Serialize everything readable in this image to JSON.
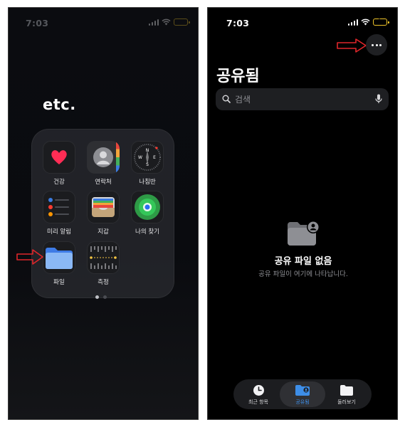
{
  "left": {
    "status": {
      "time": "7:03"
    },
    "folder_title": "etc.",
    "apps": [
      {
        "label": "건강",
        "icon": "health-heart-icon"
      },
      {
        "label": "연락처",
        "icon": "contacts-icon"
      },
      {
        "label": "나침반",
        "icon": "compass-icon"
      },
      {
        "label": "미리 알림",
        "icon": "reminders-icon"
      },
      {
        "label": "지갑",
        "icon": "wallet-icon"
      },
      {
        "label": "나의 찾기",
        "icon": "find-my-icon"
      },
      {
        "label": "파일",
        "icon": "files-folder-icon"
      },
      {
        "label": "측정",
        "icon": "measure-icon"
      }
    ],
    "compass_letters": {
      "n": "N",
      "e": "E",
      "s": "S",
      "w": "W"
    }
  },
  "right": {
    "status": {
      "time": "7:03"
    },
    "page_title": "공유됨",
    "search": {
      "placeholder": "검색"
    },
    "empty_state": {
      "title": "공유 파일 없음",
      "subtitle": "공유 파일이 여기에 나타납니다."
    },
    "tabs": [
      {
        "label": "최근 항목",
        "icon": "clock-icon",
        "active": false
      },
      {
        "label": "공유됨",
        "icon": "shared-folder-icon",
        "active": true
      },
      {
        "label": "둘러보기",
        "icon": "folder-icon",
        "active": false
      }
    ]
  },
  "colors": {
    "annotation_arrow": "#e0262a",
    "tab_active": "#3d8ee8",
    "battery": "#f0c52a"
  }
}
